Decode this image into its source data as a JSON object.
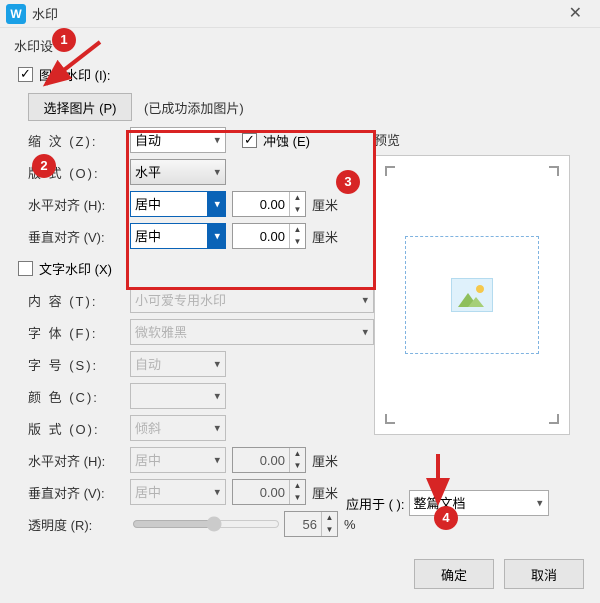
{
  "titlebar": {
    "title": "水印"
  },
  "section": {
    "heading": "水印设"
  },
  "image_wm": {
    "checkbox_label": "图片水印 (I):",
    "checked": true,
    "select_button": "选择图片 (P)",
    "hint": "(已成功添加图片)"
  },
  "fields": {
    "zoom": {
      "label": "缩    汶 (Z):",
      "value": "自动"
    },
    "erode": {
      "label": "冲蚀 (E)",
      "checked": true
    },
    "layout": {
      "label": "版    式 (O):",
      "value": "水平"
    },
    "halign": {
      "label": "水平对齐 (H):",
      "value": "居中",
      "offset": "0.00",
      "unit": "厘米"
    },
    "valign": {
      "label": "垂直对齐 (V):",
      "value": "居中",
      "offset": "0.00",
      "unit": "厘米"
    }
  },
  "text_wm": {
    "checkbox_label": "文字水印 (X)",
    "checked": false,
    "content": {
      "label": "内    容 (T):",
      "value": "小可爱专用水印"
    },
    "font": {
      "label": "字    体 (F):",
      "value": "微软雅黑"
    },
    "size": {
      "label": "字    号 (S):",
      "value": "自动"
    },
    "color": {
      "label": "颜    色 (C):"
    },
    "layout": {
      "label": "版    式 (O):",
      "value": "倾斜"
    },
    "halign": {
      "label": "水平对齐 (H):",
      "value": "居中",
      "offset": "0.00",
      "unit": "厘米"
    },
    "valign": {
      "label": "垂直对齐 (V):",
      "value": "居中",
      "offset": "0.00",
      "unit": "厘米"
    },
    "opacity": {
      "label": "透明度 (R):",
      "value": "56",
      "unit": "%"
    }
  },
  "preview": {
    "label": "预览"
  },
  "apply": {
    "label": "应用于 (   ):",
    "value": "整篇文档"
  },
  "buttons": {
    "ok": "确定",
    "cancel": "取消"
  },
  "annotations": {
    "b1": "1",
    "b2": "2",
    "b3": "3",
    "b4": "4"
  }
}
